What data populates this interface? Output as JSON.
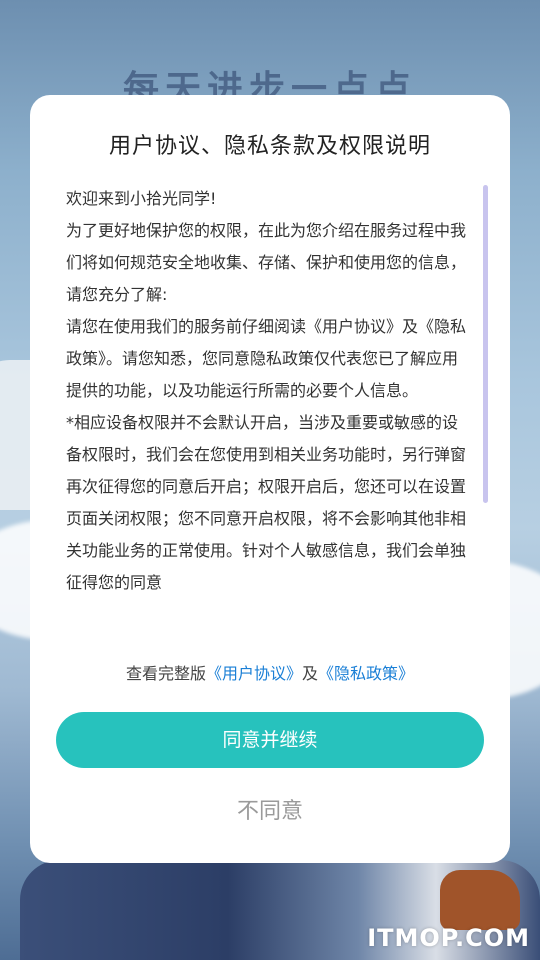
{
  "background": {
    "headline": "每天进步一点点"
  },
  "dialog": {
    "title": "用户协议、隐私条款及权限说明",
    "paragraphs": [
      "欢迎来到小拾光同学!",
      "为了更好地保护您的权限，在此为您介绍在服务过程中我们将如何规范安全地收集、存储、保护和使用您的信息，请您充分了解:",
      "请您在使用我们的服务前仔细阅读《用户协议》及《隐私政策》。请您知悉，您同意隐私政策仅代表您已了解应用提供的功能，以及功能运行所需的必要个人信息。",
      "*相应设备权限并不会默认开启，当涉及重要或敏感的设备权限时，我们会在您使用到相关业务功能时，另行弹窗再次征得您的同意后开启；权限开启后，您还可以在设置页面关闭权限；您不同意开启权限，将不会影响其他非相关功能业务的正常使用。针对个人敏感信息，我们会单独征得您的同意"
    ],
    "links_prefix": "查看完整版",
    "user_agreement_link": "《用户协议》",
    "links_conjunction": "及",
    "privacy_policy_link": "《隐私政策》",
    "agree_label": "同意并继续",
    "disagree_label": "不同意"
  },
  "watermark": "ITMOP.COM",
  "colors": {
    "accent": "#27c2bd",
    "link": "#1a7fd6",
    "scrollbar": "#c8c4ee"
  }
}
